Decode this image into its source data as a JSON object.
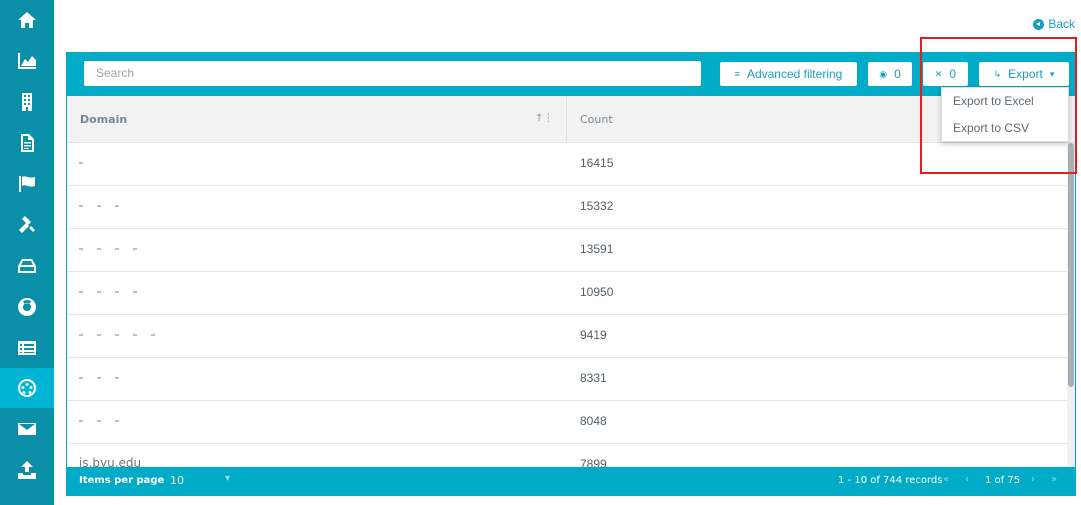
{
  "sidebar": {
    "items": [
      {
        "icon": "home-icon",
        "active": false
      },
      {
        "icon": "area-chart-icon",
        "active": false
      },
      {
        "icon": "building-icon",
        "active": false
      },
      {
        "icon": "document-icon",
        "active": false
      },
      {
        "icon": "flag-icon",
        "active": false
      },
      {
        "icon": "gavel-icon",
        "active": false
      },
      {
        "icon": "hard-drive-icon",
        "active": false
      },
      {
        "icon": "life-ring-icon",
        "active": false
      },
      {
        "icon": "list-icon",
        "active": false
      },
      {
        "icon": "network-icon",
        "active": true
      },
      {
        "icon": "envelope-icon",
        "active": false
      },
      {
        "icon": "upload-icon",
        "active": false
      }
    ]
  },
  "header": {
    "back_label": "Back"
  },
  "toolbar": {
    "search_placeholder": "Search",
    "advanced_filtering_label": "Advanced filtering",
    "visible_count": "0",
    "hidden_count": "0",
    "export_label": "Export"
  },
  "export_menu": {
    "items": [
      "Export to Excel",
      "Export to CSV"
    ]
  },
  "table": {
    "columns": [
      "Domain",
      "Count"
    ],
    "rows": [
      {
        "domain": "",
        "count": "16415"
      },
      {
        "domain": "",
        "count": "15332"
      },
      {
        "domain": "",
        "count": "13591"
      },
      {
        "domain": "",
        "count": "10950"
      },
      {
        "domain": "",
        "count": "9419"
      },
      {
        "domain": "",
        "count": "8331"
      },
      {
        "domain": "",
        "count": "8048"
      },
      {
        "domain": "is.byu.edu",
        "count": "7899"
      }
    ]
  },
  "footer": {
    "items_per_page_label": "Items per page",
    "items_per_page_value": "10",
    "records_text": "1 - 10 of 744 records",
    "page_text": "1 of 75"
  },
  "colors": {
    "sidebar": "#0a8fa8",
    "accent": "#00abc8",
    "highlight": "#e02020"
  }
}
